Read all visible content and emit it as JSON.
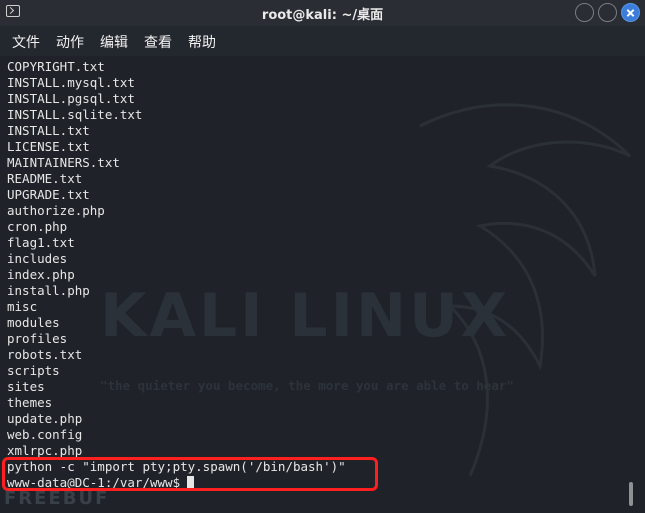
{
  "window": {
    "title": "root@kali: ~/桌面"
  },
  "menubar": {
    "items": [
      "文件",
      "动作",
      "编辑",
      "查看",
      "帮助"
    ]
  },
  "terminal": {
    "lines": [
      "COPYRIGHT.txt",
      "INSTALL.mysql.txt",
      "INSTALL.pgsql.txt",
      "INSTALL.sqlite.txt",
      "INSTALL.txt",
      "LICENSE.txt",
      "MAINTAINERS.txt",
      "README.txt",
      "UPGRADE.txt",
      "authorize.php",
      "cron.php",
      "flag1.txt",
      "includes",
      "index.php",
      "install.php",
      "misc",
      "modules",
      "profiles",
      "robots.txt",
      "scripts",
      "sites",
      "themes",
      "update.php",
      "web.config",
      "xmlrpc.php",
      "python -c \"import pty;pty.spawn('/bin/bash')\""
    ],
    "prompt": "www-data@DC-1:/var/www$"
  },
  "background": {
    "watermark": "KALI LINUX",
    "tagline": "\"the quieter you become, the more you are able to hear\"",
    "source_mark": "FREEBUF"
  },
  "colors": {
    "highlight_border": "#ff1f1f",
    "close_button": "#3b7dd8",
    "terminal_bg": "#1f2329",
    "text": "#e6e6e6"
  }
}
